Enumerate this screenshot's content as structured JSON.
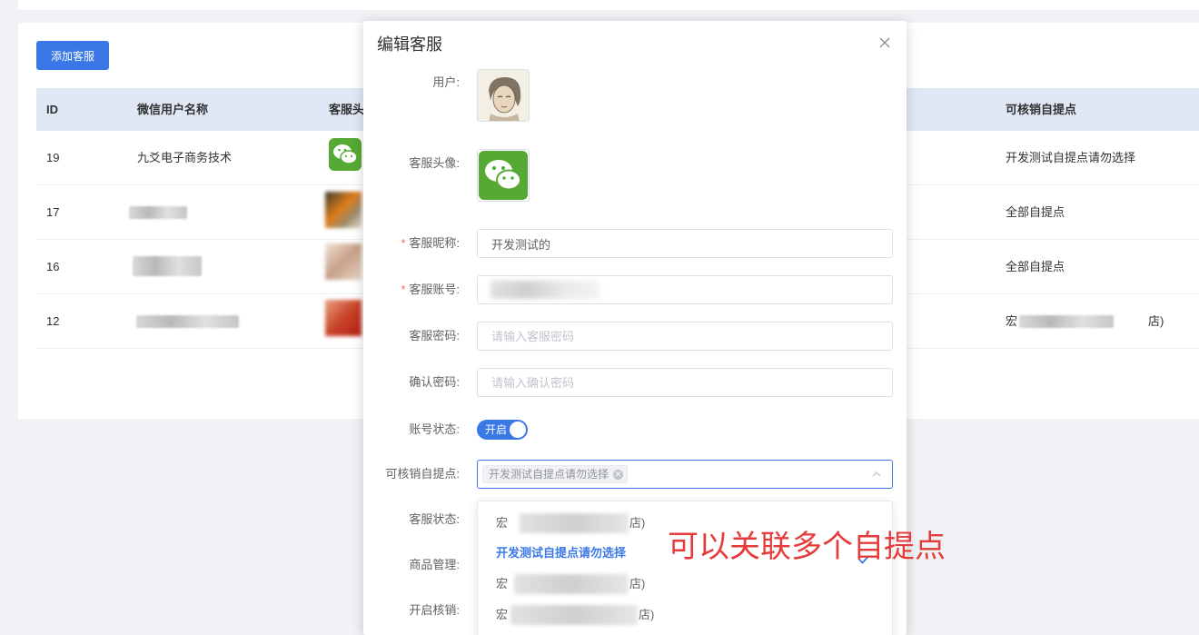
{
  "toolbar": {
    "add_label": "添加客服"
  },
  "table": {
    "headers": {
      "id": "ID",
      "name": "微信用户名称",
      "avatar": "客服头",
      "pickup": "可核销自提点"
    },
    "rows": [
      {
        "id": "19",
        "name": "九爻电子商务技术",
        "pickup": "开发测试自提点请勿选择"
      },
      {
        "id": "17",
        "name": "",
        "pickup": "全部自提点"
      },
      {
        "id": "16",
        "name": "",
        "pickup": "全部自提点"
      },
      {
        "id": "12",
        "name": "",
        "pickup_prefix": "宏",
        "pickup_suffix": "店)"
      }
    ]
  },
  "dialog": {
    "title": "编辑客服",
    "labels": {
      "user": "用户:",
      "avatar": "客服头像:",
      "nickname": "客服昵称:",
      "account": "客服账号:",
      "password": "客服密码:",
      "confirm": "确认密码:",
      "status": "账号状态:",
      "pickup": "可核销自提点:",
      "service_status": "客服状态:",
      "goods": "商品管理:",
      "verify": "开启核销:"
    },
    "nickname_value": "开发测试的",
    "account_value": "",
    "password_placeholder": "请输入客服密码",
    "confirm_placeholder": "请输入确认密码",
    "switch_label": "开启",
    "selected_tag": "开发测试自提点请勿选择",
    "options": [
      {
        "prefix": "宏",
        "suffix": "店)"
      },
      {
        "label": "开发测试自提点请勿选择"
      },
      {
        "prefix": "宏",
        "suffix": "店)"
      },
      {
        "prefix": "宏",
        "suffix": "店)"
      }
    ]
  },
  "annotation": "可以关联多个自提点",
  "colors": {
    "primary": "#3a78e8",
    "required": "#f56c6c",
    "annotation": "#e53b3b",
    "wechat": "#56a934"
  }
}
